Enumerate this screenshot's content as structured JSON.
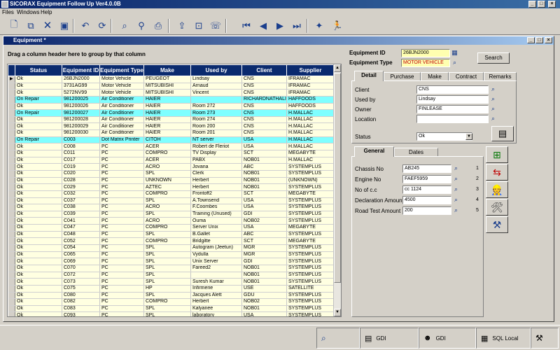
{
  "window": {
    "title": "SICORAX Equipment Follow Up Ver4.0.0B"
  },
  "menu": [
    "Files",
    "Windows",
    "Help"
  ],
  "toolbar_icons": [
    "new-icon",
    "copy-icon",
    "delete-icon",
    "save-icon",
    "undo-icon",
    "refresh-icon",
    "find-icon",
    "filter-icon",
    "print-preview-icon",
    "print-icon",
    "export-icon",
    "preview-icon",
    "fax-icon",
    "first-record-icon",
    "prev-record-icon",
    "next-record-icon",
    "last-record-icon",
    "wizard-icon",
    "run-icon"
  ],
  "child": {
    "title": "Equipment *",
    "group_hint": "Drag a column header here to group by that column"
  },
  "grid": {
    "columns": [
      "Status",
      "Equipment ID",
      "Equipment Type",
      "Make",
      "Used by",
      "Client",
      "Supplier"
    ],
    "rows": [
      {
        "s": "Ok",
        "id": "26BJN2000",
        "type": "Motor Vehicle",
        "make": "PEUGEOT",
        "used": "Lindsay",
        "client": "CNS",
        "sup": "IFRAMAC",
        "k": "y"
      },
      {
        "s": "Ok",
        "id": "3731AG99",
        "type": "Motor Vehicle",
        "make": "MITSUBISHI",
        "used": "Arnaud",
        "client": "CNS",
        "sup": "IFRAMAC",
        "k": "y"
      },
      {
        "s": "Ok",
        "id": "5272NV99",
        "type": "Motor Vehicle",
        "make": "MITSUBISHI",
        "used": "Vincent",
        "client": "CNS",
        "sup": "IFRAMAC",
        "k": "y"
      },
      {
        "s": "On Repair",
        "id": "981200025",
        "type": "Air Conditioner",
        "make": "HAIER",
        "used": "",
        "client": "RICHARDNATHALIE",
        "sup": "HAFFOODS",
        "k": "c"
      },
      {
        "s": "Ok",
        "id": "981200026",
        "type": "Air Conditioner",
        "make": "HAIER",
        "used": "Room 272",
        "client": "CNS",
        "sup": "HAFFOODS",
        "k": "y"
      },
      {
        "s": "On Repair",
        "id": "981200027",
        "type": "Air Conditioner",
        "make": "HAIER",
        "used": "Room 273",
        "client": "CNS",
        "sup": "H.MALLAC",
        "k": "c"
      },
      {
        "s": "Ok",
        "id": "981200028",
        "type": "Air Conditioner",
        "make": "HAIER",
        "used": "Room 274",
        "client": "CNS",
        "sup": "H.MALLAC",
        "k": "y"
      },
      {
        "s": "Ok",
        "id": "981200029",
        "type": "Air Conditioner",
        "make": "HAIER",
        "used": "Room 200",
        "client": "CNS",
        "sup": "H.MALLAC",
        "k": "y"
      },
      {
        "s": "Ok",
        "id": "981200030",
        "type": "Air Conditioner",
        "make": "HAIER",
        "used": "Room 201",
        "client": "CNS",
        "sup": "H.MALLAC",
        "k": "y"
      },
      {
        "s": "On Repair",
        "id": "C003",
        "type": "Dot Matrix Printer",
        "make": "CITOH",
        "used": "NT server",
        "client": "USA",
        "sup": "H.MALLAC",
        "k": "c"
      },
      {
        "s": "Ok",
        "id": "C008",
        "type": "PC",
        "make": "ACER",
        "used": "Robert de Fleriot",
        "client": "USA",
        "sup": "H.MALLAC",
        "k": "y"
      },
      {
        "s": "Ok",
        "id": "C011",
        "type": "PC",
        "make": "COMPRO",
        "used": "TV Display",
        "client": "SCT",
        "sup": "MEGABYTE",
        "k": "y"
      },
      {
        "s": "Ok",
        "id": "C017",
        "type": "PC",
        "make": "ACER",
        "used": "PABX",
        "client": "NOB01",
        "sup": "H.MALLAC",
        "k": "y"
      },
      {
        "s": "Ok",
        "id": "C019",
        "type": "PC",
        "make": "ACRO",
        "used": "Jovana",
        "client": "ABC",
        "sup": "SYSTEMPLUS",
        "k": "y"
      },
      {
        "s": "Ok",
        "id": "C020",
        "type": "PC",
        "make": "SPL",
        "used": "Clerk",
        "client": "NOB01",
        "sup": "SYSTEMPLUS",
        "k": "y"
      },
      {
        "s": "Ok",
        "id": "C028",
        "type": "PC",
        "make": "UNKNOWN",
        "used": "Herbert",
        "client": "NOB01",
        "sup": "(UNKNOWN)",
        "k": "y"
      },
      {
        "s": "Ok",
        "id": "C029",
        "type": "PC",
        "make": "AZTEC",
        "used": "Herbert",
        "client": "NOB01",
        "sup": "SYSTEMPLUS",
        "k": "y"
      },
      {
        "s": "Ok",
        "id": "C032",
        "type": "PC",
        "make": "COMPRO",
        "used": "Frontoff2",
        "client": "SCT",
        "sup": "MEGABYTE",
        "k": "y"
      },
      {
        "s": "Ok",
        "id": "C037",
        "type": "PC",
        "make": "SPL",
        "used": "A.Townsend",
        "client": "USA",
        "sup": "SYSTEMPLUS",
        "k": "y"
      },
      {
        "s": "Ok",
        "id": "C038",
        "type": "PC",
        "make": "ACRO",
        "used": "F.Coombes",
        "client": "USA",
        "sup": "SYSTEMPLUS",
        "k": "y"
      },
      {
        "s": "Ok",
        "id": "C039",
        "type": "PC",
        "make": "SPL",
        "used": "Training (Unused)",
        "client": "GDI",
        "sup": "SYSTEMPLUS",
        "k": "y"
      },
      {
        "s": "Ok",
        "id": "C041",
        "type": "PC",
        "make": "ACRO",
        "used": "Ouma",
        "client": "NOB02",
        "sup": "SYSTEMPLUS",
        "k": "y"
      },
      {
        "s": "Ok",
        "id": "C047",
        "type": "PC",
        "make": "COMPRO",
        "used": "Server Unix",
        "client": "USA",
        "sup": "MEGABYTE",
        "k": "y"
      },
      {
        "s": "Ok",
        "id": "C048",
        "type": "PC",
        "make": "SPL",
        "used": "B.Gallet",
        "client": "ABC",
        "sup": "SYSTEMPLUS",
        "k": "y"
      },
      {
        "s": "Ok",
        "id": "C052",
        "type": "PC",
        "make": "COMPRO",
        "used": "Bridgitte",
        "client": "SCT",
        "sup": "MEGABYTE",
        "k": "y"
      },
      {
        "s": "Ok",
        "id": "C054",
        "type": "PC",
        "make": "SPL",
        "used": "Autogram (Jeetun)",
        "client": "MGR",
        "sup": "SYSTEMPLUS",
        "k": "y"
      },
      {
        "s": "Ok",
        "id": "C065",
        "type": "PC",
        "make": "SPL",
        "used": "Vydulla",
        "client": "MGR",
        "sup": "SYSTEMPLUS",
        "k": "y"
      },
      {
        "s": "Ok",
        "id": "C069",
        "type": "PC",
        "make": "SPL",
        "used": "Unix Server",
        "client": "GDI",
        "sup": "SYSTEMPLUS",
        "k": "y"
      },
      {
        "s": "Ok",
        "id": "C070",
        "type": "PC",
        "make": "SPL",
        "used": "Fareed2",
        "client": "NOB01",
        "sup": "SYSTEMPLUS",
        "k": "y"
      },
      {
        "s": "Ok",
        "id": "C072",
        "type": "PC",
        "make": "SPL",
        "used": "",
        "client": "NOB01",
        "sup": "SYSTEMPLUS",
        "k": "y"
      },
      {
        "s": "Ok",
        "id": "C073",
        "type": "PC",
        "make": "SPL",
        "used": "Suresh Kumar",
        "client": "NOB01",
        "sup": "SYSTEMPLUS",
        "k": "y"
      },
      {
        "s": "Ok",
        "id": "C075",
        "type": "PC",
        "make": "HP",
        "used": "Infirmerie",
        "client": "USE",
        "sup": "SATELLITE",
        "k": "y"
      },
      {
        "s": "Ok",
        "id": "C080",
        "type": "PC",
        "make": "SPL",
        "used": "Jacques Alett",
        "client": "GDU",
        "sup": "SYSTEMPLUS",
        "k": "y"
      },
      {
        "s": "Ok",
        "id": "C082",
        "type": "PC",
        "make": "COMPRO",
        "used": "Herbert",
        "client": "NOB02",
        "sup": "SYSTEMPLUS",
        "k": "y"
      },
      {
        "s": "Ok",
        "id": "C083",
        "type": "PC",
        "make": "SPL",
        "used": "Kalyanee",
        "client": "NOB01",
        "sup": "SYSTEMPLUS",
        "k": "y"
      },
      {
        "s": "Ok",
        "id": "C093",
        "type": "PC",
        "make": "SPL",
        "used": "laboratory",
        "client": "USA",
        "sup": "SYSTEMPLUS",
        "k": "y"
      }
    ]
  },
  "detail": {
    "equipment_id_label": "Equipment ID",
    "equipment_id_value": "26BJN2000",
    "equipment_type_label": "Equipment Type",
    "equipment_type_value": "MOTOR VEHICLE",
    "search_button": "Search",
    "tabs": [
      "Detail",
      "Purchase",
      "Make",
      "Contract",
      "Remarks"
    ],
    "client_label": "Client",
    "client_value": "CNS",
    "usedby_label": "Used by",
    "usedby_value": "Lindsay",
    "owner_label": "Owner",
    "owner_value": "FINLEASE",
    "location_label": "Location",
    "location_value": "",
    "status_label": "Status",
    "status_value": "Ok"
  },
  "general": {
    "tabs": [
      "General",
      "Dates"
    ],
    "fields": [
      {
        "label": "Chassis No",
        "value": "AB245",
        "n": "1"
      },
      {
        "label": "Engine No",
        "value": "FAEF5959",
        "n": "2"
      },
      {
        "label": "No of c.c",
        "value": "cc 1124",
        "n": "3"
      },
      {
        "label": "Declaration Amount",
        "value": "4500",
        "n": "4"
      },
      {
        "label": "Road Test Amount",
        "value": "200",
        "n": "5"
      }
    ]
  },
  "statusbar": {
    "cell1": "GDI",
    "cell2": "GDI",
    "cell3": "SQL Local"
  }
}
